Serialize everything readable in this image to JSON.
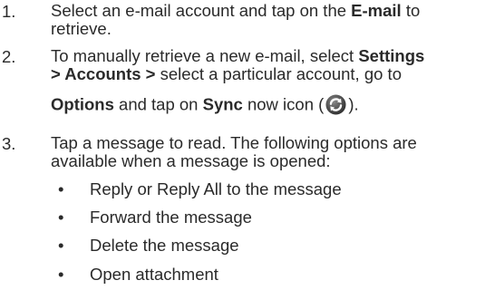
{
  "steps": [
    {
      "number": "1.",
      "text_a": "Select an e-mail account and tap on the ",
      "bold_a": "E-mail",
      "text_b": " to",
      "line2": "retrieve."
    },
    {
      "number": "2.",
      "text_a": "To manually retrieve a new e-mail, select ",
      "bold_a": "Settings",
      "line2_bold": "> Accounts >",
      "line2_text": " select a particular account, go to",
      "line3_bold1": "Options",
      "line3_text1": " and tap on ",
      "line3_bold2": "Sync",
      "line3_text2": " now icon (",
      "line3_text3": ")."
    },
    {
      "number": "3.",
      "line1": "Tap a message to read. The following options are",
      "line2": "available when a message is opened:"
    }
  ],
  "bullets": [
    {
      "marker": "•",
      "text": "Reply or Reply All to the message"
    },
    {
      "marker": "•",
      "text": "Forward the message"
    },
    {
      "marker": "•",
      "text": "Delete the message"
    },
    {
      "marker": "•",
      "text": "Open attachment"
    }
  ],
  "icons": {
    "sync": "sync-icon"
  }
}
